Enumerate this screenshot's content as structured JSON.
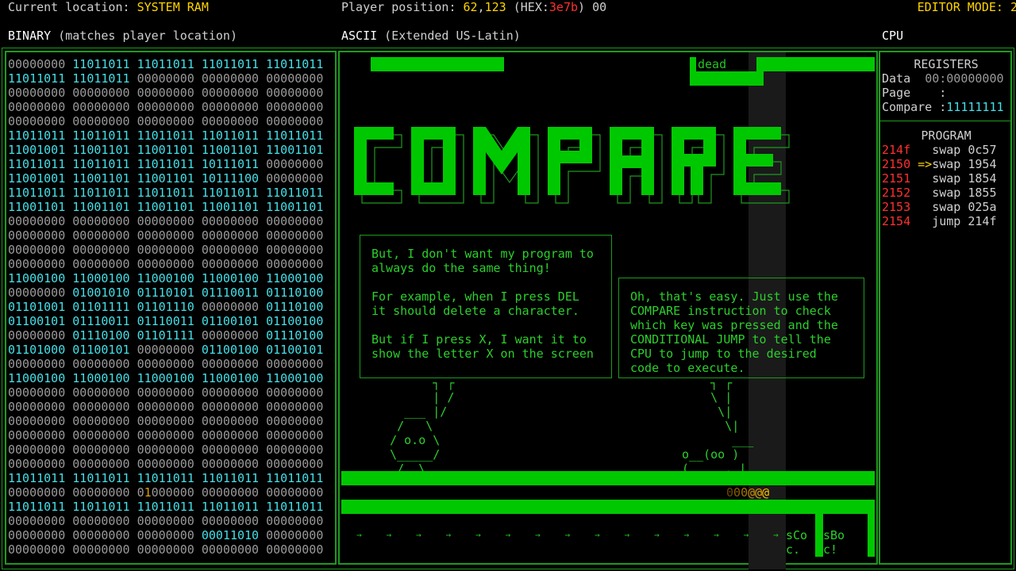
{
  "header": {
    "location_label": "Current location: ",
    "location_value": "SYSTEM RAM",
    "position_label": "Player position: ",
    "position_x": "62",
    "position_sep": ",",
    "position_y": "123",
    "hex_open": " (HEX:",
    "hex_value": "3e7b",
    "hex_close": ") 00",
    "editor_mode": "EDITOR MODE: 2",
    "binary_label": "BINARY",
    "binary_sub": " (matches player location)",
    "ascii_label": "ASCII",
    "ascii_sub": " (Extended US-Latin)",
    "cpu_label": "CPU"
  },
  "binary_rows": [
    [
      "00000000",
      "11011011",
      "11011011",
      "11011011",
      "11011011"
    ],
    [
      "11011011",
      "11011011",
      "00000000",
      "00000000",
      "00000000"
    ],
    [
      "00000000",
      "00000000",
      "00000000",
      "00000000",
      "00000000"
    ],
    [
      "00000000",
      "00000000",
      "00000000",
      "00000000",
      "00000000"
    ],
    [
      "00000000",
      "00000000",
      "00000000",
      "00000000",
      "00000000"
    ],
    [
      "11011011",
      "11011011",
      "11011011",
      "11011011",
      "11011011"
    ],
    [
      "11001001",
      "11001101",
      "11001101",
      "11001101",
      "11001101"
    ],
    [
      "11011011",
      "11011011",
      "11011011",
      "10111011",
      "00000000"
    ],
    [
      "11001001",
      "11001101",
      "11001101",
      "10111100",
      "00000000"
    ],
    [
      "11011011",
      "11011011",
      "11011011",
      "11011011",
      "11011011"
    ],
    [
      "11001101",
      "11001101",
      "11001101",
      "11001101",
      "11001101"
    ],
    [
      "00000000",
      "00000000",
      "00000000",
      "00000000",
      "00000000"
    ],
    [
      "00000000",
      "00000000",
      "00000000",
      "00000000",
      "00000000"
    ],
    [
      "00000000",
      "00000000",
      "00000000",
      "00000000",
      "00000000"
    ],
    [
      "00000000",
      "00000000",
      "00000000",
      "00000000",
      "00000000"
    ],
    [
      "11000100",
      "11000100",
      "11000100",
      "11000100",
      "11000100"
    ],
    [
      "00000000",
      "01001010",
      "01110101",
      "01110011",
      "01110100"
    ],
    [
      "01101001",
      "01101111",
      "01101110",
      "00000000",
      "01110100"
    ],
    [
      "01100101",
      "01110011",
      "01110011",
      "01100101",
      "01100100"
    ],
    [
      "00000000",
      "01110100",
      "01101111",
      "00000000",
      "01110100"
    ],
    [
      "01101000",
      "01100101",
      "00000000",
      "01100100",
      "01100101"
    ],
    [
      "00000000",
      "00000000",
      "00000000",
      "00000000",
      "00000000"
    ],
    [
      "11000100",
      "11000100",
      "11000100",
      "11000100",
      "11000100"
    ],
    [
      "00000000",
      "00000000",
      "00000000",
      "00000000",
      "00000000"
    ],
    [
      "00000000",
      "00000000",
      "00000000",
      "00000000",
      "00000000"
    ],
    [
      "00000000",
      "00000000",
      "00000000",
      "00000000",
      "00000000"
    ],
    [
      "00000000",
      "00000000",
      "00000000",
      "00000000",
      "00000000"
    ],
    [
      "00000000",
      "00000000",
      "00000000",
      "00000000",
      "00000000"
    ],
    [
      "00000000",
      "00000000",
      "00000000",
      "00000000",
      "00000000"
    ],
    [
      "11011011",
      "11011011",
      "11011011",
      "11011011",
      "11011011"
    ],
    [
      "00000000",
      "00000000",
      "01000000",
      "00000000",
      "00000000"
    ],
    [
      "11011011",
      "11011011",
      "11011011",
      "11011011",
      "11011011"
    ],
    [
      "00000000",
      "00000000",
      "00000000",
      "00000000",
      "00000000"
    ],
    [
      "00000000",
      "00000000",
      "00000000",
      "00011010",
      "00000000"
    ],
    [
      "00000000",
      "00000000",
      "00000000",
      "00000000",
      "00000000"
    ]
  ],
  "ascii_view": {
    "dead_label": "dead",
    "big_word": "COMPARE",
    "bubble_left": "But, I don't want my program to\nalways do the same thing!\n\nFor example, when I press DEL\nit should delete a character.\n\nBut if I press X, I want it to\nshow the letter X on the screen",
    "bubble_right": "Oh, that's easy. Just use the\nCOMPARE instruction to check\nwhich key was pressed and the\nCONDITIONAL JUMP to tell the\nCPU to jump to the desired\ncode to execute.",
    "player_char": "@",
    "arrow_glyph": "→",
    "sign_left": "sCo\nc.",
    "sign_right": "sBo\nc!"
  },
  "cpu": {
    "registers_title": "REGISTERS",
    "data_label": "Data  ",
    "data_value": "00:00000000",
    "page_label": "Page    :",
    "compare_label": "Compare :",
    "compare_value": "11111111",
    "program_title": "PROGRAM",
    "program": [
      {
        "addr": "214f",
        "marker": "   ",
        "op": "swap 0c57"
      },
      {
        "addr": "2150",
        "marker": " =>",
        "op": "swap 1954"
      },
      {
        "addr": "2151",
        "marker": "   ",
        "op": "swap 1854"
      },
      {
        "addr": "2152",
        "marker": "   ",
        "op": "swap 1855"
      },
      {
        "addr": "2153",
        "marker": "   ",
        "op": "swap 025a"
      },
      {
        "addr": "2154",
        "marker": "   ",
        "op": "jump 214f"
      }
    ]
  },
  "colors": {
    "accent_green": "#00c800",
    "frame_green": "#1e9a1e",
    "highlight_yellow": "#ffd400",
    "address_red": "#ff3030",
    "binary_cyan": "#44e0e8"
  }
}
